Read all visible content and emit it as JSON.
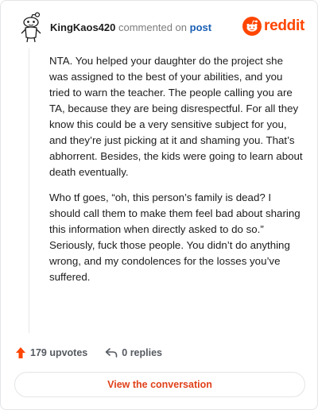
{
  "header": {
    "author": "KingKaos420",
    "action_text": "commented on",
    "post_link": "post",
    "brand": "reddit",
    "brand_color": "#ff4500"
  },
  "comment": {
    "paragraphs": [
      "NTA. You helped your daughter do the project she was assigned to the best of your abilities, and you tried to warn the teacher. The people calling you are TA, because they are being disrespectful. For all they know this could be a very sensitive subject for you, and they’re just picking at it and shaming you. That’s abhorrent. Besides, the kids were going to learn about death eventually.",
      "Who tf goes, “oh, this person’s family is dead? I should call them to make them feel bad about sharing this information when directly asked to do so.” Seriously, fuck those people. You didn’t do anything wrong, and my condolences for the losses you’ve suffered."
    ]
  },
  "actions": {
    "upvotes": "179 upvotes",
    "replies": "0 replies",
    "upvote_icon": "upvote-arrow-icon",
    "reply_icon": "reply-arrow-icon"
  },
  "footer": {
    "view_button": "View the conversation"
  }
}
